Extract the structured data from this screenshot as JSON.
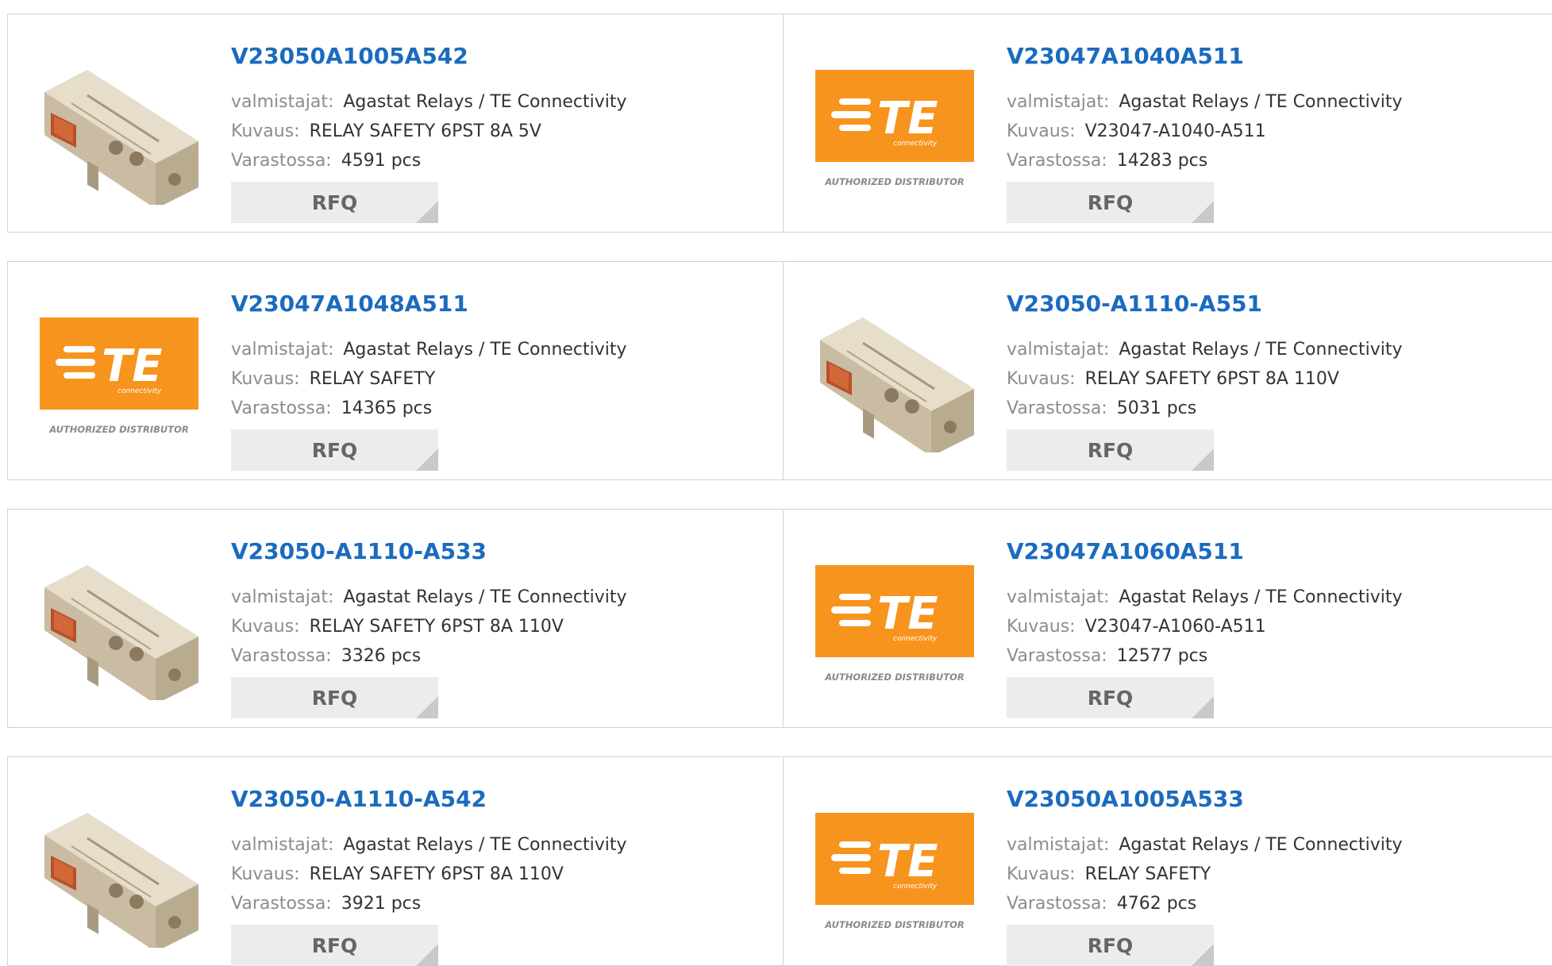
{
  "labels": {
    "manufacturer": "valmistajat:",
    "description": "Kuvaus:",
    "stock": "Varastossa:",
    "rfq": "RFQ"
  },
  "products": [
    {
      "part": "V23050A1005A542",
      "manufacturer": "Agastat Relays / TE Connectivity",
      "description": "RELAY SAFETY 6PST 8A 5V",
      "stock": "4591 pcs",
      "image": "relay-photo"
    },
    {
      "part": "V23047A1040A511",
      "manufacturer": "Agastat Relays / TE Connectivity",
      "description": "V23047-A1040-A511",
      "stock": "14283 pcs",
      "image": "te-logo"
    },
    {
      "part": "V23047A1048A511",
      "manufacturer": "Agastat Relays / TE Connectivity",
      "description": "RELAY SAFETY",
      "stock": "14365 pcs",
      "image": "te-logo"
    },
    {
      "part": "V23050-A1110-A551",
      "manufacturer": "Agastat Relays / TE Connectivity",
      "description": "RELAY SAFETY 6PST 8A 110V",
      "stock": "5031 pcs",
      "image": "relay-photo"
    },
    {
      "part": "V23050-A1110-A533",
      "manufacturer": "Agastat Relays / TE Connectivity",
      "description": "RELAY SAFETY 6PST 8A 110V",
      "stock": "3326 pcs",
      "image": "relay-photo"
    },
    {
      "part": "V23047A1060A511",
      "manufacturer": "Agastat Relays / TE Connectivity",
      "description": "V23047-A1060-A511",
      "stock": "12577 pcs",
      "image": "te-logo"
    },
    {
      "part": "V23050-A1110-A542",
      "manufacturer": "Agastat Relays / TE Connectivity",
      "description": "RELAY SAFETY 6PST 8A 110V",
      "stock": "3921 pcs",
      "image": "relay-photo"
    },
    {
      "part": "V23050A1005A533",
      "manufacturer": "Agastat Relays / TE Connectivity",
      "description": "RELAY SAFETY",
      "stock": "4762 pcs",
      "image": "te-logo"
    }
  ],
  "logo": {
    "mark": "TE",
    "sub": "connectivity",
    "caption": "AUTHORIZED DISTRIBUTOR"
  },
  "colors": {
    "link": "#1a6bbf",
    "brand_orange": "#f7941d",
    "label_gray": "#8c8c8c",
    "button_bg": "#ececec"
  }
}
